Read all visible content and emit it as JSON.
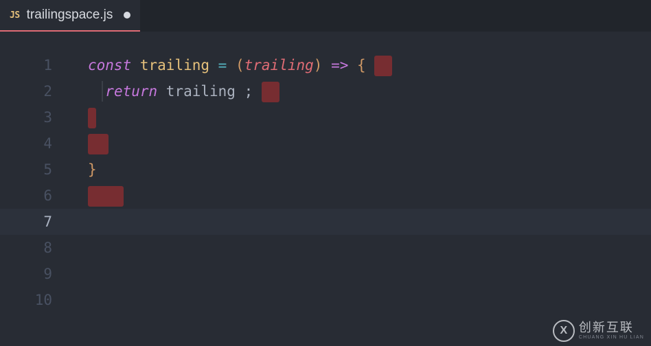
{
  "tab": {
    "icon_label": "JS",
    "filename": "trailingspace.js",
    "dirty": true
  },
  "gutter": {
    "lines": [
      "1",
      "2",
      "3",
      "4",
      "5",
      "6",
      "7",
      "8",
      "9",
      "10"
    ],
    "active_line": 7
  },
  "code": {
    "line1": {
      "kw": "const",
      "name": "trailing",
      "eq": " = ",
      "paren_open": "(",
      "param": "trailing",
      "paren_close": ")",
      "arrow": " => ",
      "brace_open": "{"
    },
    "line2": {
      "ret": "return",
      "id": " trailing ",
      "semi": ";"
    },
    "line5": {
      "brace_close": "}"
    }
  },
  "watermark": {
    "logo_letter": "X",
    "cn": "创新互联",
    "en": "CHUANG XIN HU LIAN"
  }
}
